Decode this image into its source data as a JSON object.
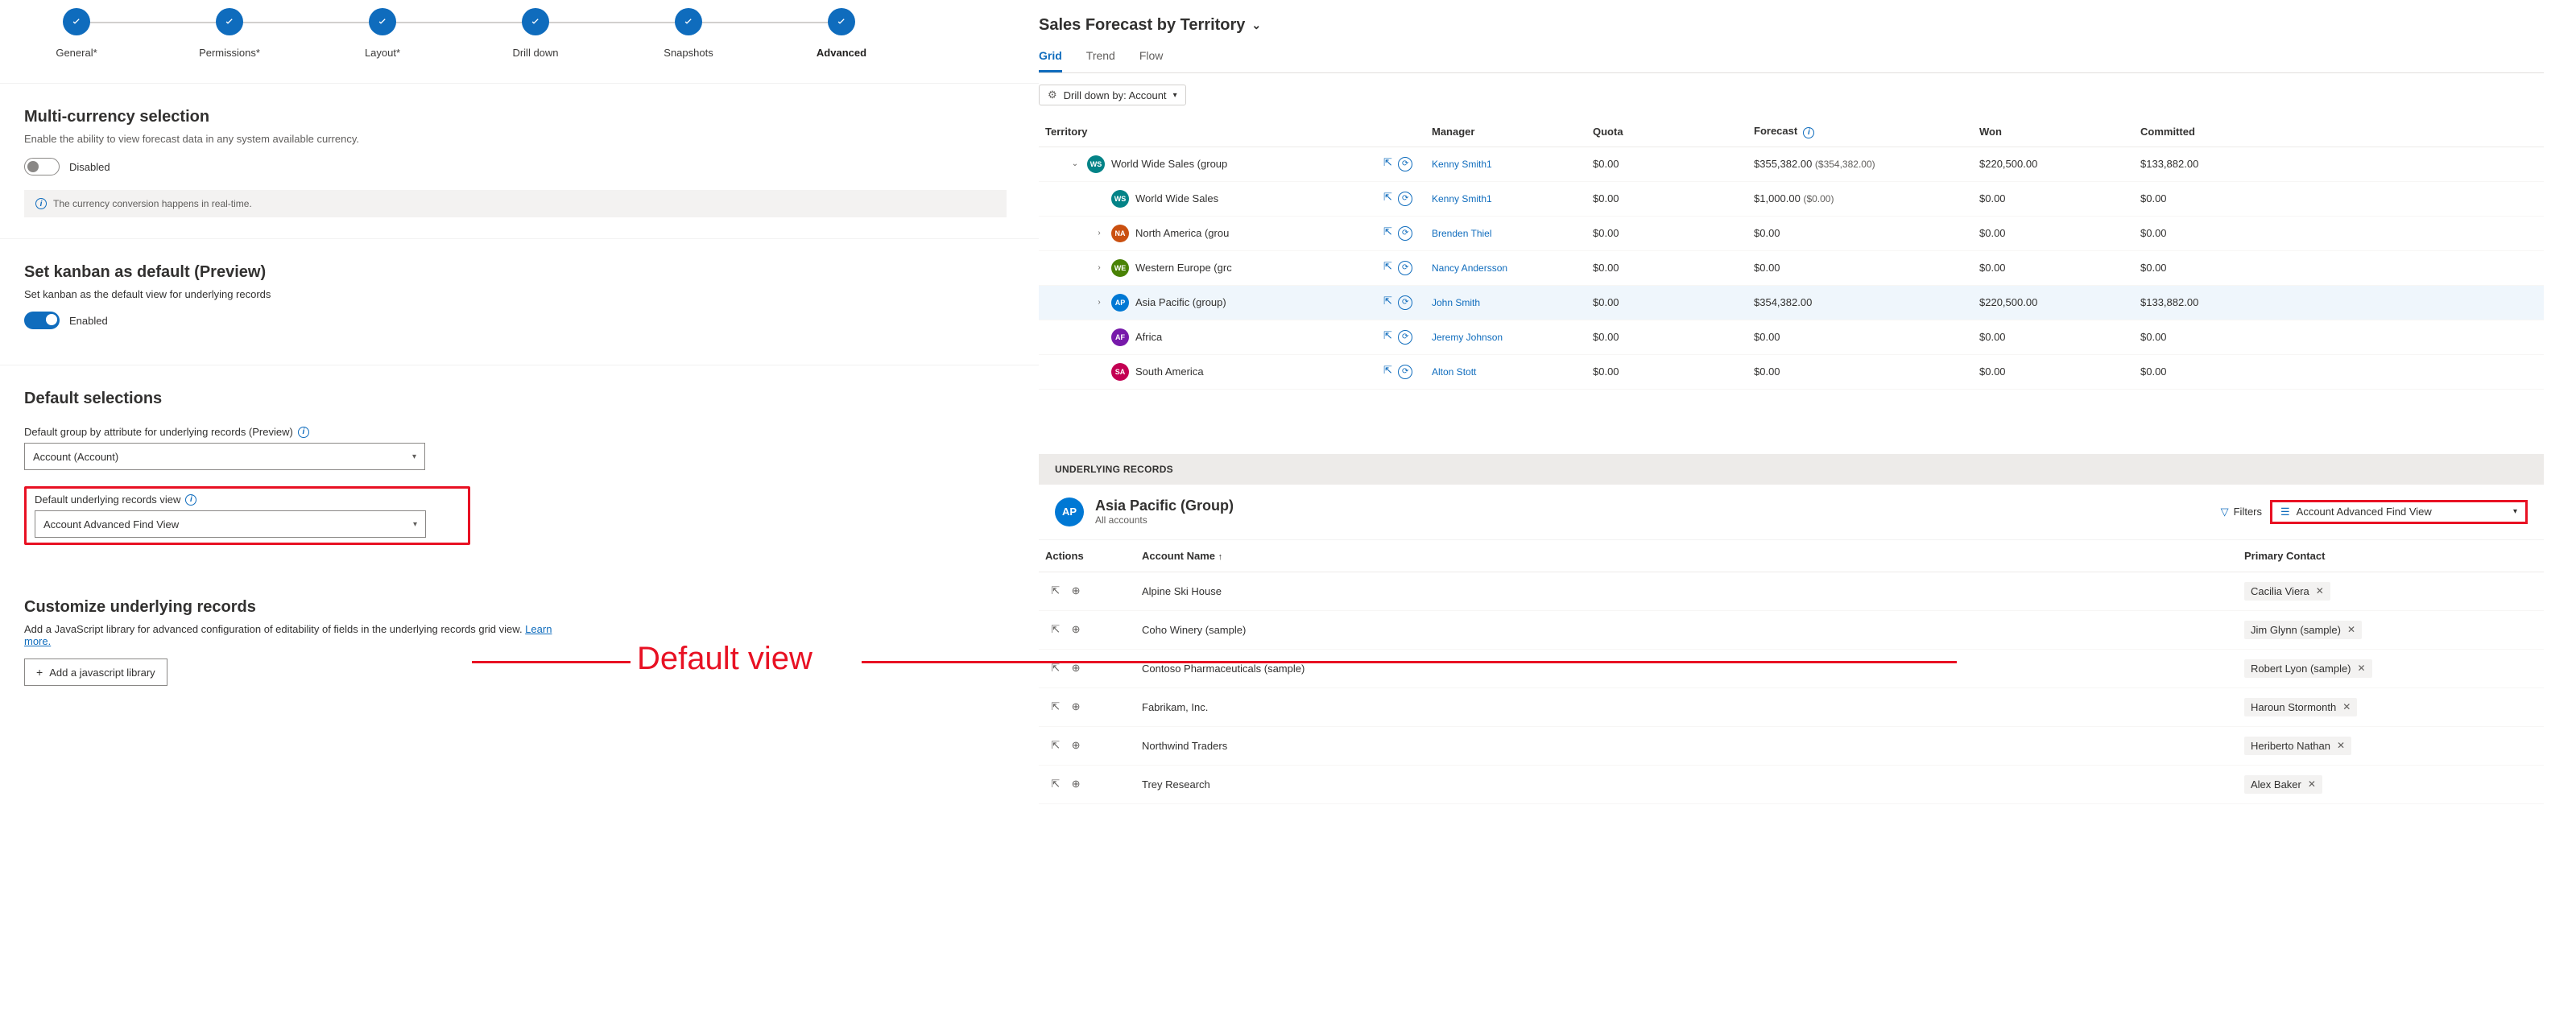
{
  "stepper": {
    "steps": [
      {
        "label": "General*"
      },
      {
        "label": "Permissions*"
      },
      {
        "label": "Layout*"
      },
      {
        "label": "Drill down"
      },
      {
        "label": "Snapshots"
      },
      {
        "label": "Advanced"
      }
    ]
  },
  "multi_currency": {
    "title": "Multi-currency selection",
    "desc": "Enable the ability to view forecast data in any system available currency.",
    "toggle_label": "Disabled",
    "info_text": "The currency conversion happens in real-time."
  },
  "kanban": {
    "title": "Set kanban as default (Preview)",
    "desc": "Set kanban as the default view for underlying records",
    "toggle_label": "Enabled"
  },
  "default_selections": {
    "title": "Default selections",
    "groupby_label": "Default group by attribute for underlying records (Preview)",
    "groupby_value": "Account (Account)",
    "view_label": "Default underlying records view",
    "view_value": "Account Advanced Find View"
  },
  "customize": {
    "title": "Customize underlying records",
    "desc_pre": "Add a JavaScript library for advanced configuration of editability of fields in the underlying records grid view. ",
    "learn_more": "Learn more.",
    "button": "Add a javascript library"
  },
  "annotation": "Default view",
  "right": {
    "title": "Sales Forecast by Territory",
    "tabs": [
      "Grid",
      "Trend",
      "Flow"
    ],
    "drilldown_label": "Drill down by: Account",
    "columns": {
      "territory": "Territory",
      "manager": "Manager",
      "quota": "Quota",
      "forecast": "Forecast",
      "won": "Won",
      "committed": "Committed"
    },
    "rows": [
      {
        "indent": 0,
        "exp": "down",
        "avc": "ws",
        "ini": "WS",
        "name": "World Wide Sales (group",
        "mgr": "Kenny Smith1",
        "q": "$0.00",
        "f": "$355,382.00",
        "fs": "($354,382.00)",
        "w": "$220,500.00",
        "c": "$133,882.00",
        "sel": false
      },
      {
        "indent": 1,
        "exp": "",
        "avc": "ws",
        "ini": "WS",
        "name": "World Wide Sales",
        "mgr": "Kenny Smith1",
        "q": "$0.00",
        "f": "$1,000.00",
        "fs": "($0.00)",
        "w": "$0.00",
        "c": "$0.00",
        "sel": false
      },
      {
        "indent": 1,
        "exp": "right",
        "avc": "na",
        "ini": "NA",
        "name": "North America (grou",
        "mgr": "Brenden Thiel",
        "q": "$0.00",
        "f": "$0.00",
        "fs": "",
        "w": "$0.00",
        "c": "$0.00",
        "sel": false
      },
      {
        "indent": 1,
        "exp": "right",
        "avc": "we",
        "ini": "WE",
        "name": "Western Europe (grc",
        "mgr": "Nancy Andersson",
        "q": "$0.00",
        "f": "$0.00",
        "fs": "",
        "w": "$0.00",
        "c": "$0.00",
        "sel": false
      },
      {
        "indent": 1,
        "exp": "right",
        "avc": "ap",
        "ini": "AP",
        "name": "Asia Pacific (group)",
        "mgr": "John Smith",
        "q": "$0.00",
        "f": "$354,382.00",
        "fs": "",
        "w": "$220,500.00",
        "c": "$133,882.00",
        "sel": true
      },
      {
        "indent": 1,
        "exp": "",
        "avc": "af",
        "ini": "AF",
        "name": "Africa",
        "mgr": "Jeremy Johnson",
        "q": "$0.00",
        "f": "$0.00",
        "fs": "",
        "w": "$0.00",
        "c": "$0.00",
        "sel": false
      },
      {
        "indent": 1,
        "exp": "",
        "avc": "sa",
        "ini": "SA",
        "name": "South America",
        "mgr": "Alton Stott",
        "q": "$0.00",
        "f": "$0.00",
        "fs": "",
        "w": "$0.00",
        "c": "$0.00",
        "sel": false
      }
    ],
    "underlying_header": "UNDERLYING RECORDS",
    "under_title": "Asia Pacific (Group)",
    "under_sub": "All accounts",
    "filters_label": "Filters",
    "view_picker": "Account Advanced Find View",
    "rec_cols": {
      "actions": "Actions",
      "acct": "Account Name",
      "contact": "Primary Contact"
    },
    "recs": [
      {
        "acct": "Alpine Ski House",
        "contact": "Cacilia Viera"
      },
      {
        "acct": "Coho Winery (sample)",
        "contact": "Jim Glynn (sample)"
      },
      {
        "acct": "Contoso Pharmaceuticals (sample)",
        "contact": "Robert Lyon (sample)"
      },
      {
        "acct": "Fabrikam, Inc.",
        "contact": "Haroun Stormonth"
      },
      {
        "acct": "Northwind Traders",
        "contact": "Heriberto Nathan"
      },
      {
        "acct": "Trey Research",
        "contact": "Alex Baker"
      }
    ]
  }
}
